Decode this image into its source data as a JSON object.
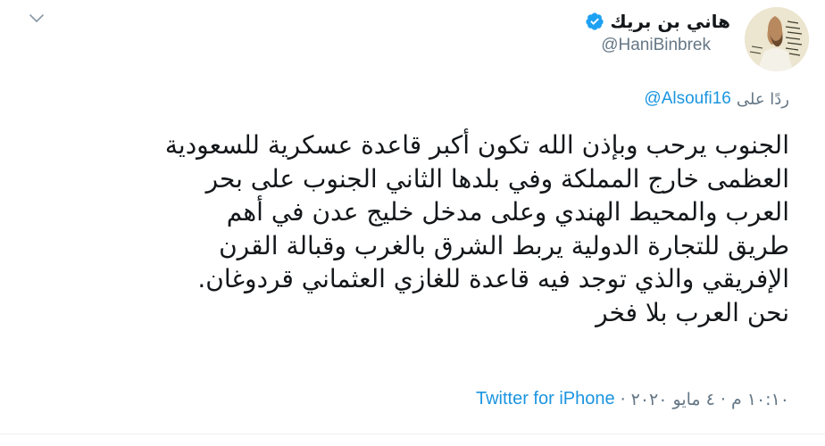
{
  "tweet": {
    "author": {
      "display_name": "هاني بن بريك",
      "handle": "@HaniBinbrek",
      "verified": true,
      "avatar_icon": "avatar-portrait-icon"
    },
    "menu_icon": "chevron-down-icon",
    "reply": {
      "prefix": "ردًا على",
      "to": "@Alsoufi16"
    },
    "text": "الجنوب يرحب وبإذن الله تكون أكبر قاعدة عسكرية للسعودية\nالعظمى خارج المملكة وفي بلدها الثاني الجنوب على بحر\nالعرب والمحيط الهندي وعلى مدخل خليج عدن في أهم\nطريق للتجارة الدولية يربط الشرق بالغرب وقبالة القرن\nالإفريقي والذي توجد فيه قاعدة للغازي العثماني قردوغان.\nنحن العرب بلا فخر",
    "timestamp": "١٠:١٠ م · ٤ مايو ٢٠٢٠",
    "separator": "·",
    "source": "Twitter for iPhone",
    "colors": {
      "link": "#1b95e0",
      "muted": "#657786",
      "text": "#14171a",
      "verified": "#1da1f2"
    }
  }
}
